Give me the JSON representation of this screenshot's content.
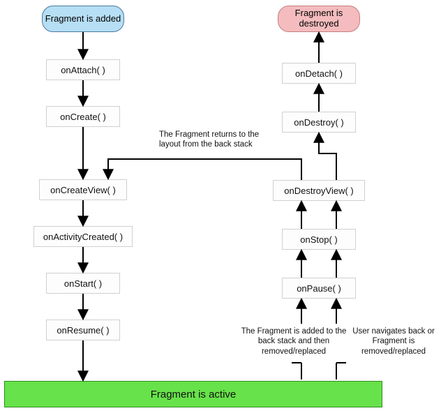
{
  "chart_data": {
    "type": "flow",
    "nodes": [
      {
        "id": "added",
        "label": "Fragment is\nadded",
        "kind": "start",
        "column": "left"
      },
      {
        "id": "onAttach",
        "label": "onAttach( )",
        "kind": "method",
        "column": "left"
      },
      {
        "id": "onCreate",
        "label": "onCreate( )",
        "kind": "method",
        "column": "left"
      },
      {
        "id": "onCreateView",
        "label": "onCreateView( )",
        "kind": "method",
        "column": "left"
      },
      {
        "id": "onActivityCreated",
        "label": "onActivityCreated( )",
        "kind": "method",
        "column": "left"
      },
      {
        "id": "onStart",
        "label": "onStart( )",
        "kind": "method",
        "column": "left"
      },
      {
        "id": "onResume",
        "label": "onResume( )",
        "kind": "method",
        "column": "left"
      },
      {
        "id": "active",
        "label": "Fragment is active",
        "kind": "state",
        "column": "center"
      },
      {
        "id": "onPause",
        "label": "onPause( )",
        "kind": "method",
        "column": "right"
      },
      {
        "id": "onStop",
        "label": "onStop( )",
        "kind": "method",
        "column": "right"
      },
      {
        "id": "onDestroyView",
        "label": "onDestroyView( )",
        "kind": "method",
        "column": "right"
      },
      {
        "id": "onDestroy",
        "label": "onDestroy( )",
        "kind": "method",
        "column": "right"
      },
      {
        "id": "onDetach",
        "label": "onDetach( )",
        "kind": "method",
        "column": "right"
      },
      {
        "id": "destroyed",
        "label": "Fragment is\ndestroyed",
        "kind": "end",
        "column": "right"
      }
    ],
    "edges": [
      {
        "from": "added",
        "to": "onAttach"
      },
      {
        "from": "onAttach",
        "to": "onCreate"
      },
      {
        "from": "onCreate",
        "to": "onCreateView"
      },
      {
        "from": "onCreateView",
        "to": "onActivityCreated"
      },
      {
        "from": "onActivityCreated",
        "to": "onStart"
      },
      {
        "from": "onStart",
        "to": "onResume"
      },
      {
        "from": "onResume",
        "to": "active"
      },
      {
        "from": "active",
        "to": "onPause",
        "label": "The Fragment is added to the back stack and then removed/replaced"
      },
      {
        "from": "active",
        "to": "onPause",
        "label": "User navigates back or Fragment is removed/replaced"
      },
      {
        "from": "onPause",
        "to": "onStop"
      },
      {
        "from": "onStop",
        "to": "onDestroyView"
      },
      {
        "from": "onDestroyView",
        "to": "onDestroy"
      },
      {
        "from": "onDestroy",
        "to": "onDetach"
      },
      {
        "from": "onDetach",
        "to": "destroyed"
      },
      {
        "from": "onDestroyView",
        "to": "onCreateView",
        "label": "The Fragment returns to the layout from the back stack"
      }
    ]
  },
  "start": {
    "label": "Fragment is added"
  },
  "end": {
    "label": "Fragment is destroyed"
  },
  "left": {
    "onAttach": "onAttach( )",
    "onCreate": "onCreate( )",
    "onCreateView": "onCreateView( )",
    "onActivityCreated": "onActivityCreated( )",
    "onStart": "onStart( )",
    "onResume": "onResume( )"
  },
  "right": {
    "onPause": "onPause( )",
    "onStop": "onStop( )",
    "onDestroyView": "onDestroyView( )",
    "onDestroy": "onDestroy( )",
    "onDetach": "onDetach( )"
  },
  "active": {
    "label": "Fragment is active"
  },
  "annot": {
    "returnBackstack": "The Fragment returns to the layout from the back stack",
    "addedBackstack": "The Fragment is added to the back stack and then removed/replaced",
    "userNavBack": "User navigates back or Fragment is removed/replaced"
  }
}
